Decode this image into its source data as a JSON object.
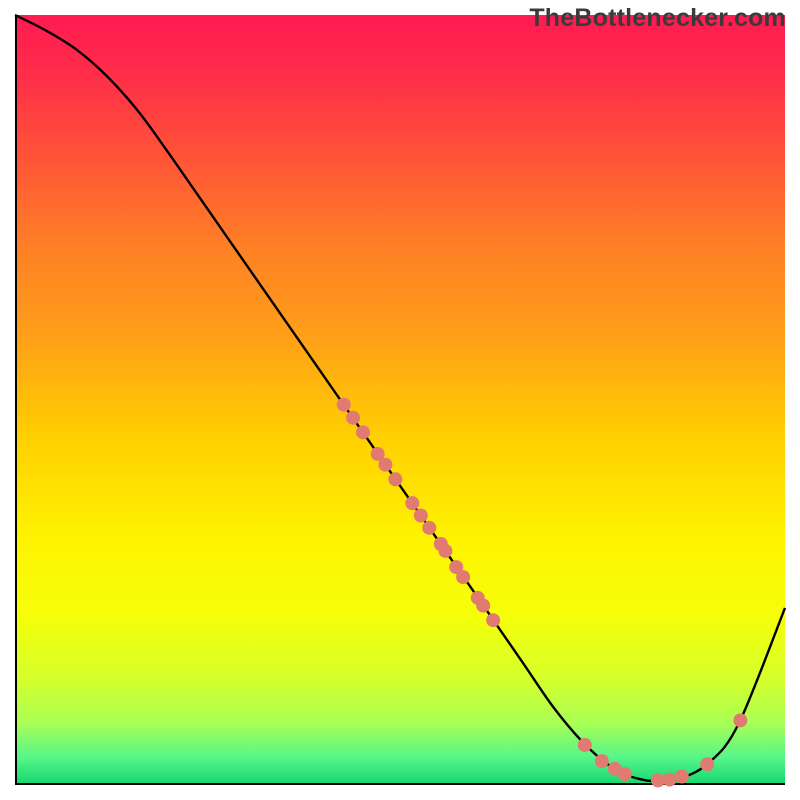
{
  "watermark": "TheBottlenecker.com",
  "chart_data": {
    "type": "line",
    "title": "",
    "xlabel": "",
    "ylabel": "",
    "xlim": [
      0,
      100
    ],
    "ylim": [
      0,
      100
    ],
    "grid": false,
    "series": [
      {
        "name": "bottleneck-curve",
        "color": "#000000",
        "x": [
          0,
          4,
          8,
          12,
          16,
          20,
          28,
          36,
          44,
          52,
          60,
          66,
          70,
          74,
          78,
          82,
          86,
          90,
          94,
          100
        ],
        "y": [
          100,
          98,
          95.5,
          92,
          87.5,
          82,
          70.5,
          59,
          47.5,
          36,
          24.5,
          15.8,
          10,
          5.3,
          2,
          0.6,
          0.8,
          2.8,
          8,
          23
        ]
      }
    ],
    "scatter_points": {
      "name": "data-points",
      "color": "#e17a70",
      "radius": 7,
      "points": [
        {
          "x": 42.7,
          "y": 49.4
        },
        {
          "x": 43.9,
          "y": 47.7
        },
        {
          "x": 45.2,
          "y": 45.8
        },
        {
          "x": 47.1,
          "y": 43.0
        },
        {
          "x": 48.1,
          "y": 41.6
        },
        {
          "x": 49.4,
          "y": 39.7
        },
        {
          "x": 51.6,
          "y": 36.6
        },
        {
          "x": 52.7,
          "y": 35.0
        },
        {
          "x": 53.8,
          "y": 33.4
        },
        {
          "x": 55.3,
          "y": 31.3
        },
        {
          "x": 55.9,
          "y": 30.4
        },
        {
          "x": 57.3,
          "y": 28.3
        },
        {
          "x": 58.2,
          "y": 27.0
        },
        {
          "x": 60.1,
          "y": 24.3
        },
        {
          "x": 60.8,
          "y": 23.3
        },
        {
          "x": 62.1,
          "y": 21.4
        },
        {
          "x": 74.0,
          "y": 5.2
        },
        {
          "x": 76.2,
          "y": 3.1
        },
        {
          "x": 77.9,
          "y": 2.1
        },
        {
          "x": 79.2,
          "y": 1.4
        },
        {
          "x": 83.5,
          "y": 0.6
        },
        {
          "x": 85.0,
          "y": 0.7
        },
        {
          "x": 86.6,
          "y": 1.1
        },
        {
          "x": 89.9,
          "y": 2.7
        },
        {
          "x": 94.2,
          "y": 8.4
        }
      ]
    },
    "gradient_stops": [
      {
        "offset": 0.0,
        "color": "#ff1a52"
      },
      {
        "offset": 0.08,
        "color": "#ff2e49"
      },
      {
        "offset": 0.18,
        "color": "#ff5238"
      },
      {
        "offset": 0.3,
        "color": "#ff7f26"
      },
      {
        "offset": 0.42,
        "color": "#ffa018"
      },
      {
        "offset": 0.55,
        "color": "#ffd000"
      },
      {
        "offset": 0.68,
        "color": "#fff300"
      },
      {
        "offset": 0.78,
        "color": "#f6ff08"
      },
      {
        "offset": 0.86,
        "color": "#d6ff2a"
      },
      {
        "offset": 0.92,
        "color": "#a8ff55"
      },
      {
        "offset": 0.965,
        "color": "#55f58a"
      },
      {
        "offset": 1.0,
        "color": "#14d66e"
      }
    ]
  }
}
